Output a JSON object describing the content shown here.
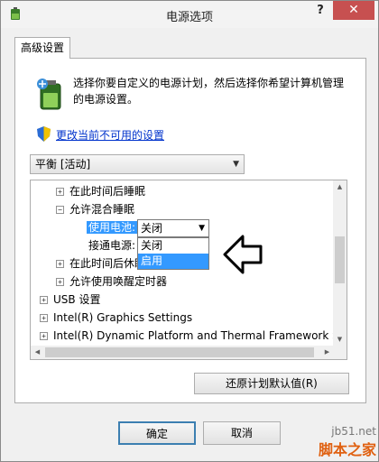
{
  "window": {
    "title": "电源选项",
    "help_label": "?",
    "close_label": "✕"
  },
  "tab": {
    "label": "高级设置"
  },
  "description": "选择你要自定义的电源计划，然后选择你希望计算机管理的电源设置。",
  "change_link": "更改当前不可用的设置",
  "plan_select": {
    "value": "平衡 [活动]"
  },
  "tree": {
    "items": [
      {
        "label": "在此时间后睡眠",
        "expander": "+"
      },
      {
        "label": "允许混合睡眠",
        "expander": "−"
      },
      {
        "label": "使用电池:",
        "selected": true
      },
      {
        "label": "接通电源:"
      },
      {
        "label": "在此时间后休眠",
        "expander": "+"
      },
      {
        "label": "允许使用唤醒定时器",
        "expander": "+"
      },
      {
        "label": "USB 设置",
        "expander": "+"
      },
      {
        "label": "Intel(R) Graphics Settings",
        "expander": "+"
      },
      {
        "label": "Intel(R) Dynamic Platform and Thermal Framework Se",
        "expander": "+"
      }
    ]
  },
  "inline_select": {
    "value": "关闭",
    "options": [
      "关闭",
      "启用"
    ],
    "highlighted": "启用"
  },
  "buttons": {
    "restore": "还原计划默认值(R)",
    "ok": "确定",
    "cancel": "取消"
  },
  "watermark": {
    "url": "jb51.net",
    "brand": "脚本之家"
  },
  "colors": {
    "accent": "#3399ff",
    "close": "#c75050",
    "link": "#0033cc"
  }
}
